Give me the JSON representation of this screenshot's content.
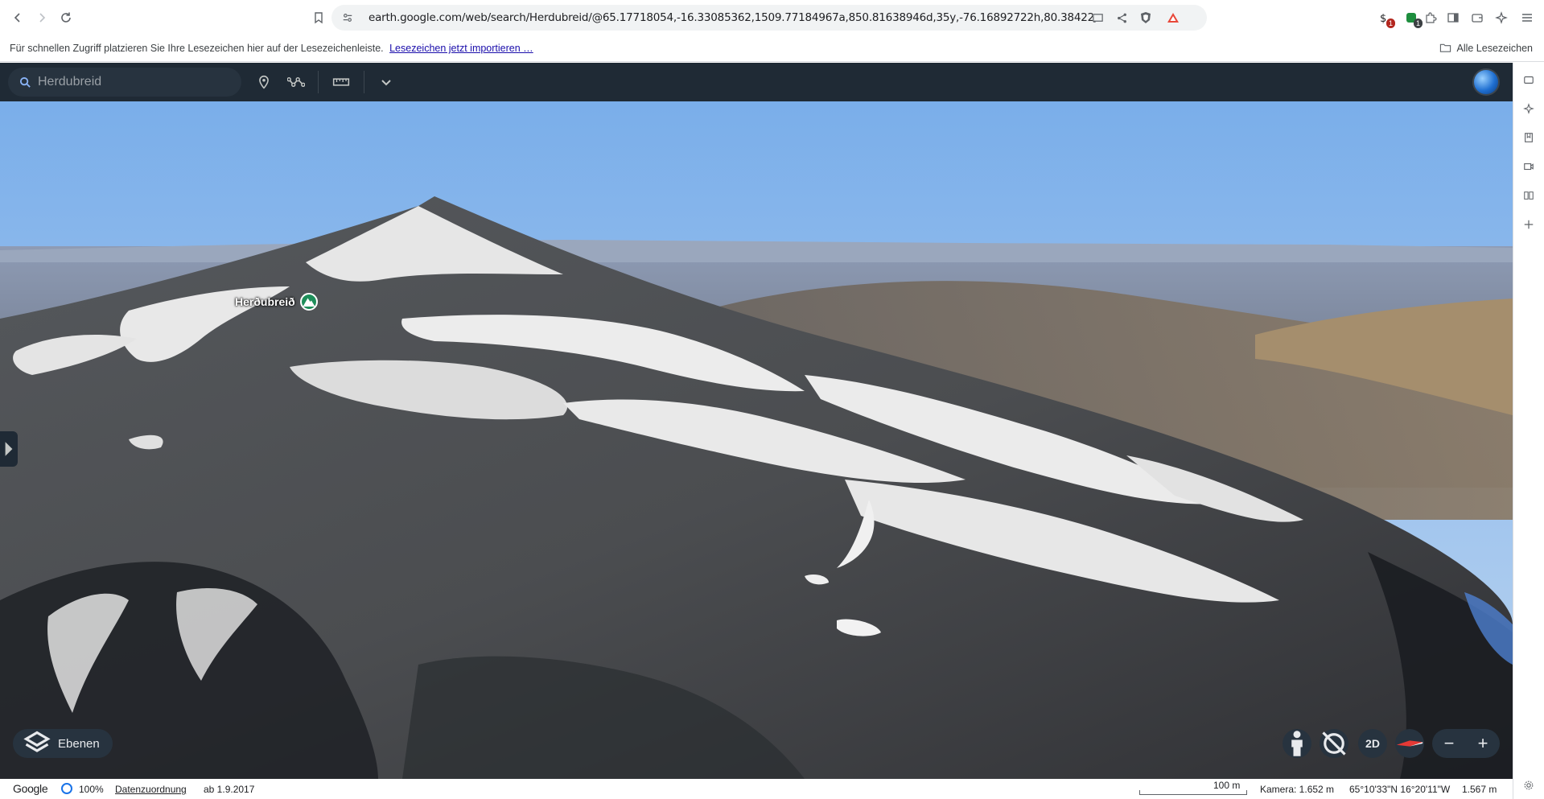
{
  "browser": {
    "url": "earth.google.com/web/search/Herdubreid/@65.17718054,-16.33085362,1509.77184967a,850.81638946d,35y,-76.16892722h,80.3842297...",
    "extensions": [
      {
        "name": "extension-1",
        "badge": "1",
        "badge_color": "#b3261e"
      },
      {
        "name": "extension-2",
        "badge": "1",
        "badge_color": "#1e8e3e"
      }
    ]
  },
  "bookmarks_bar": {
    "prompt": "Für schnellen Zugriff platzieren Sie Ihre Lesezeichen hier auf der Lesezeichenleiste.",
    "import_link": "Lesezeichen jetzt importieren …",
    "all_bookmarks": "Alle Lesezeichen"
  },
  "earth": {
    "search_placeholder": "Herdubreid",
    "place_label": "Herðubreið",
    "layers_button": "Ebenen",
    "view_mode_button": "2D",
    "status": {
      "brand": "Google",
      "load_percent": "100%",
      "attribution_link": "Datenzuordnung",
      "imagery_date": "ab 1.9.2017",
      "scale_label": "100 m",
      "camera": "Kamera: 1.652 m",
      "coordinates": "65°10'33\"N 16°20'11\"W",
      "elevation": "1.567 m"
    }
  },
  "colors": {
    "appbar": "#1f2a35",
    "accent_green": "#1e8e5a",
    "sky_top": "#7fb0ec",
    "sky_horizon": "#b8d3f0"
  }
}
